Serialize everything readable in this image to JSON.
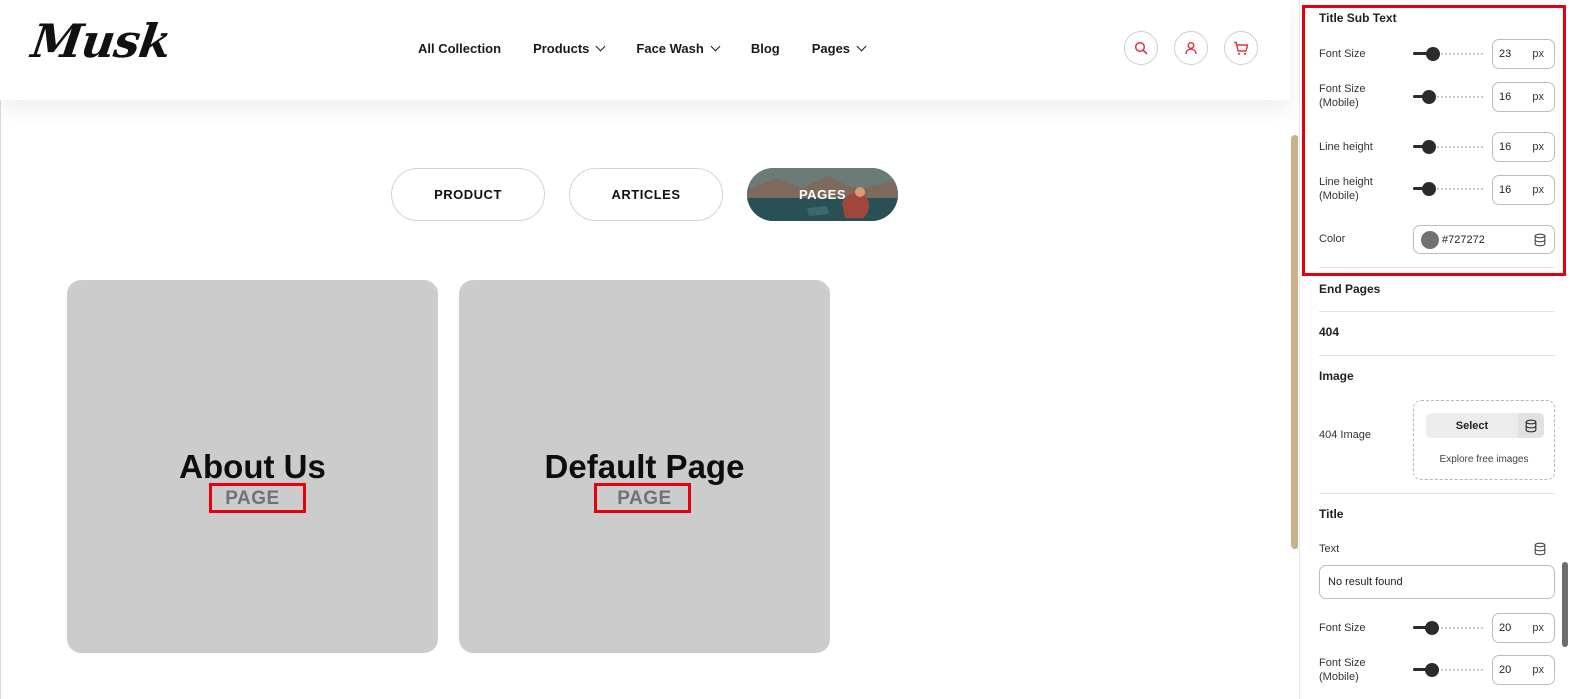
{
  "store": {
    "logo": "Musk",
    "nav": [
      {
        "label": "All Collection",
        "has_dropdown": false
      },
      {
        "label": "Products",
        "has_dropdown": true
      },
      {
        "label": "Face Wash",
        "has_dropdown": true
      },
      {
        "label": "Blog",
        "has_dropdown": false
      },
      {
        "label": "Pages",
        "has_dropdown": true
      }
    ],
    "header_icons": [
      "search-icon",
      "user-icon",
      "cart-icon"
    ],
    "accent_color": "#e0333d",
    "tabs": [
      {
        "label": "PRODUCT",
        "active": false
      },
      {
        "label": "ARTICLES",
        "active": false
      },
      {
        "label": "PAGES",
        "active": true
      }
    ],
    "cards": [
      {
        "title": "About Us",
        "subtitle": "PAGE"
      },
      {
        "title": "Default Page",
        "subtitle": "PAGE"
      }
    ]
  },
  "panel": {
    "title_sub_text": {
      "heading": "Title Sub Text",
      "font_size": {
        "label": "Font Size",
        "value": "23",
        "unit": "px",
        "level": 0.28
      },
      "font_size_mobile": {
        "label": "Font Size\n(Mobile)",
        "value": "16",
        "unit": "px",
        "level": 0.22
      },
      "line_height": {
        "label": "Line height",
        "value": "16",
        "unit": "px",
        "level": 0.22
      },
      "line_height_mobile": {
        "label": "Line height\n(Mobile)",
        "value": "16",
        "unit": "px",
        "level": 0.22
      },
      "color": {
        "label": "Color",
        "value": "#727272"
      }
    },
    "end_pages": {
      "heading": "End Pages"
    },
    "section_404": {
      "heading": "404"
    },
    "image": {
      "heading": "Image",
      "field_label": "404 Image",
      "select_label": "Select",
      "explore_label": "Explore free images"
    },
    "title": {
      "heading": "Title",
      "text_label": "Text",
      "text_value": "No result found",
      "font_size": {
        "label": "Font Size",
        "value": "20",
        "unit": "px",
        "level": 0.26
      },
      "font_size_mobile": {
        "label": "Font Size\n(Mobile)",
        "value": "20",
        "unit": "px",
        "level": 0.26
      }
    }
  },
  "highlight_color": "#e3000f"
}
